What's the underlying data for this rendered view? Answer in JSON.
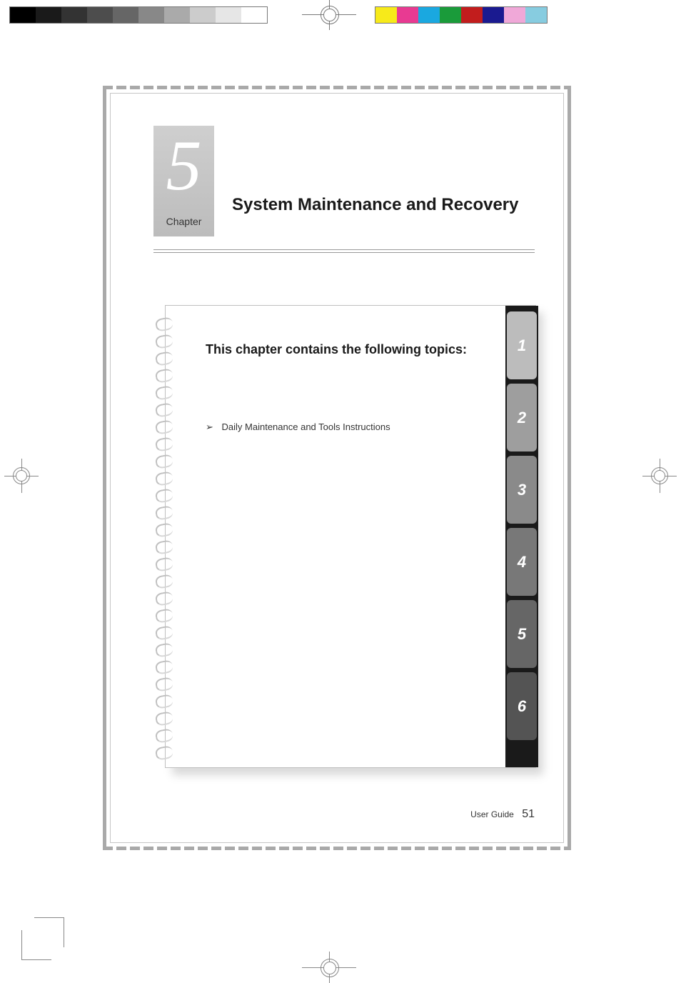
{
  "printer_marks": {
    "gray_ramp": [
      "#000000",
      "#1a1a1a",
      "#333333",
      "#4d4d4d",
      "#666666",
      "#888888",
      "#aaaaaa",
      "#cccccc",
      "#e6e6e6",
      "#ffffff"
    ],
    "color_swatches": [
      "#f7ea1a",
      "#e83a92",
      "#1aa8e0",
      "#1a9b3a",
      "#c21d1d",
      "#1a1a90",
      "#f0a8d8",
      "#87cce0"
    ]
  },
  "chapter": {
    "number": "5",
    "label": "Chapter",
    "title": "System Maintenance and Recovery"
  },
  "topics_box": {
    "heading": "This chapter contains the following topics:",
    "items": [
      "Daily Maintenance and Tools Instructions"
    ]
  },
  "tabs": [
    {
      "num": "1",
      "color": "#bcbcbc"
    },
    {
      "num": "2",
      "color": "#9e9e9e"
    },
    {
      "num": "3",
      "color": "#8a8a8a"
    },
    {
      "num": "4",
      "color": "#787878"
    },
    {
      "num": "5",
      "color": "#666666"
    },
    {
      "num": "6",
      "color": "#545454"
    }
  ],
  "footer": {
    "label": "User Guide",
    "page": "51"
  }
}
